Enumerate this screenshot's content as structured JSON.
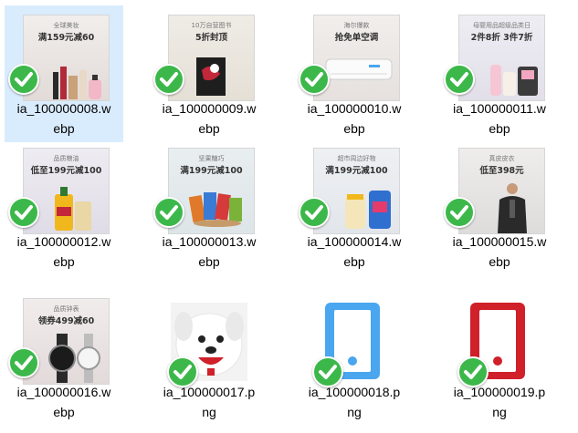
{
  "files": [
    {
      "name": "ia_100000008.webp",
      "label_line1": "ia_100000008.w",
      "label_line2": "ebp",
      "banner_sub": "全球美妆",
      "banner_main": "满159元减60",
      "selected": true,
      "icon": "cosmetics-banner"
    },
    {
      "name": "ia_100000009.webp",
      "label_line1": "ia_100000009.w",
      "label_line2": "ebp",
      "banner_sub": "10万自营图书",
      "banner_main": "5折封顶",
      "icon": "books-banner"
    },
    {
      "name": "ia_100000010.webp",
      "label_line1": "ia_100000010.w",
      "label_line2": "ebp",
      "banner_sub": "海尔爆款",
      "banner_main": "抢免单空调",
      "icon": "air-conditioner-banner"
    },
    {
      "name": "ia_100000011.webp",
      "label_line1": "ia_100000011.w",
      "label_line2": "ebp",
      "banner_sub": "母婴用品超级品类日",
      "banner_main": "2件8折 3件7折",
      "icon": "baby-products-banner"
    },
    {
      "name": "ia_100000012.webp",
      "label_line1": "ia_100000012.w",
      "label_line2": "ebp",
      "banner_sub": "品质粮油",
      "banner_main": "低至199元减100",
      "icon": "grain-oil-banner"
    },
    {
      "name": "ia_100000013.webp",
      "label_line1": "ia_100000013.w",
      "label_line2": "ebp",
      "banner_sub": "坚果糖巧",
      "banner_main": "满199元减100",
      "icon": "snacks-banner"
    },
    {
      "name": "ia_100000014.webp",
      "label_line1": "ia_100000014.w",
      "label_line2": "ebp",
      "banner_sub": "超市周边好物",
      "banner_main": "满199元减100",
      "icon": "supermarket-banner"
    },
    {
      "name": "ia_100000015.webp",
      "label_line1": "ia_100000015.w",
      "label_line2": "ebp",
      "banner_sub": "真皮皮衣",
      "banner_main": "低至398元",
      "icon": "leather-jacket-banner"
    },
    {
      "name": "ia_100000016.webp",
      "label_line1": "ia_100000016.w",
      "label_line2": "ebp",
      "banner_sub": "品质钟表",
      "banner_main": "领券499减60",
      "icon": "watches-banner"
    },
    {
      "name": "ia_100000017.png",
      "label_line1": "ia_100000017.p",
      "label_line2": "ng",
      "icon": "mascot-dog-image"
    },
    {
      "name": "ia_100000018.png",
      "label_line1": "ia_100000018.p",
      "label_line2": "ng",
      "icon": "blue-phone-icon"
    },
    {
      "name": "ia_100000019.png",
      "label_line1": "ia_100000019.p",
      "label_line2": "ng",
      "icon": "red-phone-icon"
    }
  ],
  "colors": {
    "selection": "#d9ecfd",
    "check_green": "#3cb84a",
    "phone_blue": "#4aa6ee",
    "phone_red": "#d0202a"
  }
}
